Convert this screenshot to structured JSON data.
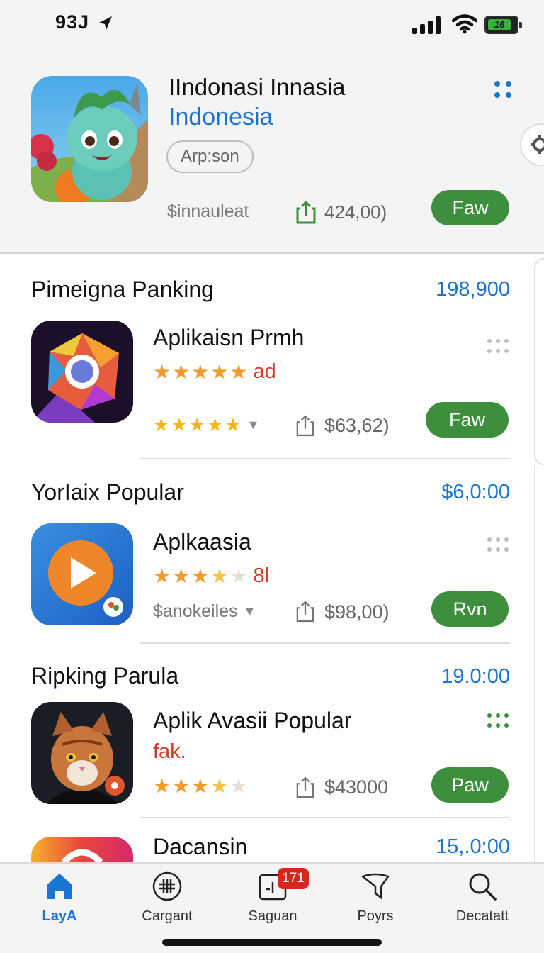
{
  "status_bar": {
    "time": "93J",
    "battery_label": "16"
  },
  "header": {
    "title": "IIndonasi Innasia",
    "subtitle": "Indonesia",
    "pill": "Arp:son",
    "meta": "$innauleat",
    "count": "424,00)",
    "button": "Faw"
  },
  "sections": [
    {
      "title": "Pimeigna Panking",
      "value": "198,900",
      "app": {
        "name": "Aplikaisn Prmh",
        "rating_text": "ad",
        "meta": "",
        "price": "$63,62)",
        "button": "Faw"
      }
    },
    {
      "title": "YorIaix Popular",
      "value": "$6,0:00",
      "app": {
        "name": "Aplkaasia",
        "rating_text": "8l",
        "meta": "$anokeiles",
        "price": "$98,00)",
        "button": "Rvn"
      }
    },
    {
      "title": "Ripking Parula",
      "value": "19.0:00",
      "app": {
        "name": "Aplik Avasii Popular",
        "rating_text": "fak.",
        "meta": "",
        "price": "$43000",
        "button": "Paw"
      }
    },
    {
      "title": "",
      "value": "15,.0:00",
      "app": {
        "name": "Dacansin"
      }
    }
  ],
  "tabbar": {
    "items": [
      {
        "label": "LayA",
        "icon": "home-icon",
        "active": true
      },
      {
        "label": "Cargant",
        "icon": "grid-circle-icon"
      },
      {
        "label": "Saguan",
        "icon": "inbox-icon",
        "badge": "171"
      },
      {
        "label": "Poyrs",
        "icon": "funnel-icon"
      },
      {
        "label": "Decatatt",
        "icon": "search-icon"
      }
    ]
  },
  "colors": {
    "accent": "#1a74d2",
    "button_green": "#3d8f3d",
    "rating_red": "#d53b2a",
    "star_orange": "#f39a2a",
    "badge_red": "#d7261e"
  }
}
